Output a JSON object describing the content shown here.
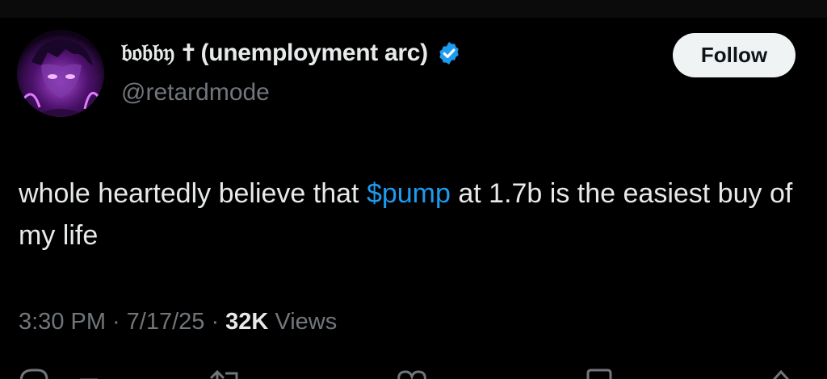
{
  "author": {
    "name_prefix": "𝔟𝔬𝔟𝔟𝔶 ✝",
    "name_main": "(unemployment arc)",
    "handle": "@retardmode",
    "verified": true,
    "avatar_icon": "anime-avatar-icon"
  },
  "follow_label": "Follow",
  "tweet": {
    "text_before": "whole heartedly believe that ",
    "cashtag": "$pump",
    "text_after": " at 1.7b is the easiest buy of my life"
  },
  "meta": {
    "time": "3:30 PM",
    "sep1": "·",
    "date": "7/17/25",
    "sep2": "·",
    "views_count": "32K",
    "views_label": "Views"
  },
  "colors": {
    "background": "#000000",
    "text": "#e7e9ea",
    "muted": "#71767b",
    "link": "#1d9bf0",
    "verified": "#1d9bf0"
  },
  "actions": {
    "icons": [
      "reply-icon",
      "retweet-icon",
      "like-icon",
      "bookmark-icon",
      "share-icon"
    ]
  }
}
